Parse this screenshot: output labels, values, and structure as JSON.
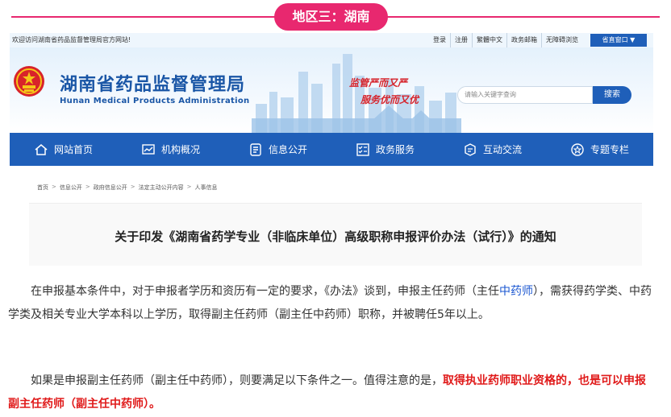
{
  "region_banner": {
    "label": "地区三：湖南"
  },
  "site": {
    "topbar": {
      "welcome": "欢迎访问湖南省药品监督管理局官方网站!",
      "links": [
        "登录",
        "注册",
        "繁體中文",
        "政务邮箱",
        "无障碍浏览"
      ],
      "group_window": "省直窗口 ▼"
    },
    "header": {
      "agency_name": "湖南省药品监督管理局",
      "agency_name_en": "Hunan Medical Products Administration",
      "slogan_line1": "监管严而又严",
      "slogan_line2": "服务优而又优",
      "search_placeholder": "请输入关键字查询",
      "search_button": "搜索"
    },
    "nav": [
      {
        "label": "网站首页",
        "icon": "home-icon"
      },
      {
        "label": "机构概况",
        "icon": "chart-icon"
      },
      {
        "label": "信息公开",
        "icon": "info-icon"
      },
      {
        "label": "政务服务",
        "icon": "checklist-icon"
      },
      {
        "label": "互动交流",
        "icon": "chat-icon"
      },
      {
        "label": "专题专栏",
        "icon": "badge-icon"
      }
    ],
    "accent_color": "#1f5fb9"
  },
  "breadcrumb": [
    "首页",
    "信息公开",
    "政府信息公开",
    "法定主动公开内容",
    "人事信息"
  ],
  "article": {
    "title": "关于印发《湖南省药学专业（非临床单位）高级职称申报评价办法（试行）》的通知",
    "para1_a": "在申报基本条件中，对于申报者学历和资历有一定的要求，《办法》谈到，申报主任药师（主任",
    "para1_link": "中药师",
    "para1_b": "），需获得药学类、中药学类及相关专业大学本科以上学历，取得副主任药师（副主任中药师）职称，并被聘任5年以上。",
    "para2_a": "如果是申报副主任药师（副主任中药师），则要满足以下条件之一。值得注意的是，",
    "para2_red": "取得执业药师职业资格的，也是可以申报副主任药师（副主任中药师）。"
  },
  "colors": {
    "banner": "#e8286f",
    "highlight_red": "#e01a1a",
    "link_blue": "#1a56d0"
  }
}
